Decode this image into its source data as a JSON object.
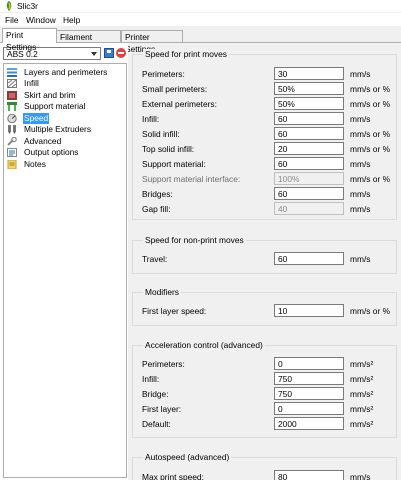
{
  "window": {
    "title": "Slic3r"
  },
  "menu": [
    {
      "label": "File"
    },
    {
      "label": "Window"
    },
    {
      "label": "Help"
    }
  ],
  "tabs": [
    {
      "label": "Print Settings",
      "active": true
    },
    {
      "label": "Filament Settings",
      "active": false
    },
    {
      "label": "Printer Settings",
      "active": false
    }
  ],
  "preset": {
    "value": "ABS 0.2"
  },
  "tree": [
    {
      "label": "Layers and perimeters",
      "icon": "layers-icon"
    },
    {
      "label": "Infill",
      "icon": "infill-icon"
    },
    {
      "label": "Skirt and brim",
      "icon": "skirt-icon"
    },
    {
      "label": "Support material",
      "icon": "support-icon"
    },
    {
      "label": "Speed",
      "icon": "speed-icon",
      "selected": true
    },
    {
      "label": "Multiple Extruders",
      "icon": "extruders-icon"
    },
    {
      "label": "Advanced",
      "icon": "wrench-icon"
    },
    {
      "label": "Output options",
      "icon": "output-icon"
    },
    {
      "label": "Notes",
      "icon": "notes-icon"
    }
  ],
  "groups": [
    {
      "title": "Speed for print moves",
      "rows": [
        {
          "label": "Perimeters:",
          "value": "30",
          "unit": "mm/s"
        },
        {
          "label": "Small perimeters:",
          "value": "50%",
          "unit": "mm/s or %"
        },
        {
          "label": "External perimeters:",
          "value": "50%",
          "unit": "mm/s or %"
        },
        {
          "label": "Infill:",
          "value": "60",
          "unit": "mm/s"
        },
        {
          "label": "Solid infill:",
          "value": "60",
          "unit": "mm/s or %"
        },
        {
          "label": "Top solid infill:",
          "value": "20",
          "unit": "mm/s or %"
        },
        {
          "label": "Support material:",
          "value": "60",
          "unit": "mm/s"
        },
        {
          "label": "Support material interface:",
          "value": "100%",
          "unit": "mm/s or %",
          "disabled": true
        },
        {
          "label": "Bridges:",
          "value": "60",
          "unit": "mm/s"
        },
        {
          "label": "Gap fill:",
          "value": "40",
          "unit": "mm/s",
          "disabled": true
        }
      ]
    },
    {
      "title": "Speed for non-print moves",
      "rows": [
        {
          "label": "Travel:",
          "value": "60",
          "unit": "mm/s"
        }
      ]
    },
    {
      "title": "Modifiers",
      "rows": [
        {
          "label": "First layer speed:",
          "value": "10",
          "unit": "mm/s or %"
        }
      ]
    },
    {
      "title": "Acceleration control (advanced)",
      "rows": [
        {
          "label": "Perimeters:",
          "value": "0",
          "unit": "mm/s²"
        },
        {
          "label": "Infill:",
          "value": "750",
          "unit": "mm/s²"
        },
        {
          "label": "Bridge:",
          "value": "750",
          "unit": "mm/s²"
        },
        {
          "label": "First layer:",
          "value": "0",
          "unit": "mm/s²"
        },
        {
          "label": "Default:",
          "value": "2000",
          "unit": "mm/s²"
        }
      ]
    },
    {
      "title": "Autospeed (advanced)",
      "rows": [
        {
          "label": "Max print speed:",
          "value": "80",
          "unit": "mm/s"
        }
      ]
    }
  ]
}
